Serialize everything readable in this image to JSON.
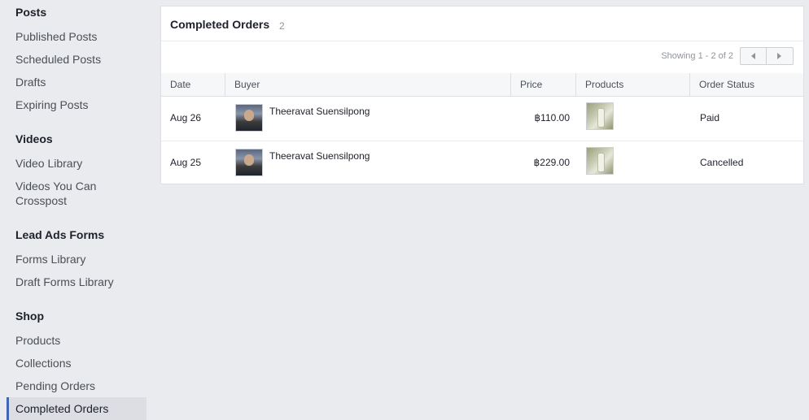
{
  "sidebar": {
    "sections": [
      {
        "title": "Posts",
        "items": [
          "Published Posts",
          "Scheduled Posts",
          "Drafts",
          "Expiring Posts"
        ]
      },
      {
        "title": "Videos",
        "items": [
          "Video Library",
          "Videos You Can Crosspost"
        ]
      },
      {
        "title": "Lead Ads Forms",
        "items": [
          "Forms Library",
          "Draft Forms Library"
        ]
      },
      {
        "title": "Shop",
        "items": [
          "Products",
          "Collections",
          "Pending Orders",
          "Completed Orders"
        ]
      }
    ],
    "active_item": "Completed Orders"
  },
  "panel": {
    "title": "Completed Orders",
    "count": "2",
    "pager_text": "Showing 1 - 2 of 2"
  },
  "table": {
    "columns": [
      "Date",
      "Buyer",
      "Price",
      "Products",
      "Order Status"
    ],
    "rows": [
      {
        "date": "Aug 26",
        "buyer": "Theeravat Suensilpong",
        "price": "฿110.00",
        "status": "Paid"
      },
      {
        "date": "Aug 25",
        "buyer": "Theeravat Suensilpong",
        "price": "฿229.00",
        "status": "Cancelled"
      }
    ]
  },
  "colors": {
    "accent": "#4267b2",
    "background": "#e9ebee"
  }
}
